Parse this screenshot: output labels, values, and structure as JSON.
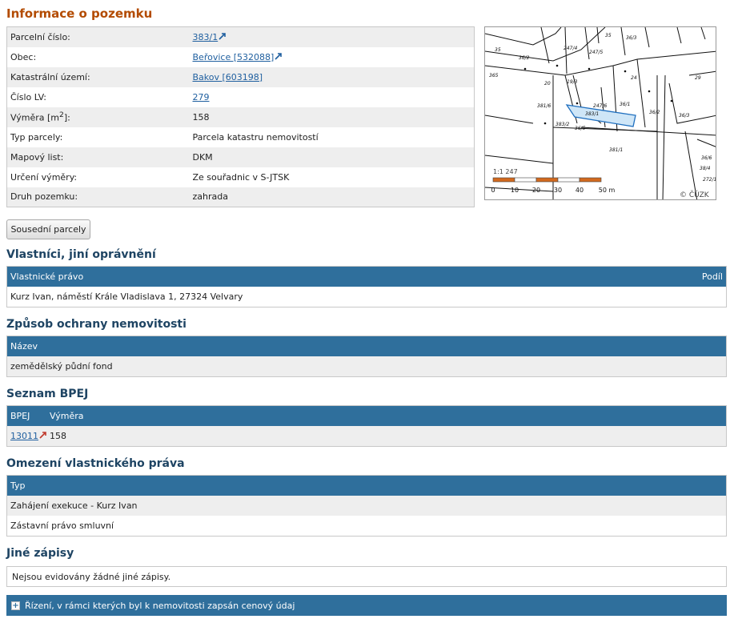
{
  "page_title": "Informace o pozemku",
  "info": {
    "rows": [
      {
        "label": "Parcelní číslo:",
        "value": "383/1",
        "link": true
      },
      {
        "label": "Obec:",
        "value": "Beřovice [532088]",
        "link": true
      },
      {
        "label": "Katastrální území:",
        "value": "Bakov [603198]",
        "link": true
      },
      {
        "label": "Číslo LV:",
        "value": "279",
        "link": true
      },
      {
        "label": "Výměra [m2]:",
        "value": "158",
        "link": false
      },
      {
        "label": "Typ parcely:",
        "value": "Parcela katastru nemovitostí",
        "link": false
      },
      {
        "label": "Mapový list:",
        "value": "DKM",
        "link": false
      },
      {
        "label": "Určení výměry:",
        "value": "Ze souřadnic v S-JTSK",
        "link": false
      },
      {
        "label": "Druh pozemku:",
        "value": "zahrada",
        "link": false
      }
    ],
    "area_label_prefix": "Výměra [m",
    "area_label_sup": "2",
    "area_label_suffix": "]:"
  },
  "map": {
    "scale_text": "1:1 247",
    "scale_ticks": [
      "0",
      "10",
      "20",
      "30",
      "40",
      "50 m"
    ],
    "copyright": "© ČÚZK",
    "parcel_labels": [
      "35",
      "36/2",
      "247/4",
      "247/5",
      "36/1",
      "36/3",
      "36/4",
      "365",
      "20",
      "19/3",
      "247/6",
      "24",
      "29",
      "36/1",
      "36/2",
      "36/3",
      "381/6",
      "383/1",
      "383/2",
      "36/5",
      "381/1",
      "38/4",
      "272/1",
      "36/6"
    ]
  },
  "buttons": {
    "neighbors": "Sousední parcely"
  },
  "owners": {
    "title": "Vlastníci, jiní oprávnění",
    "col_right": "Vlastnické právo",
    "col_share": "Podíl",
    "rows": [
      "Kurz Ivan, náměstí Krále Vladislava 1, 27324 Velvary"
    ]
  },
  "protection": {
    "title": "Způsob ochrany nemovitosti",
    "col_name": "Název",
    "rows": [
      "zemědělský půdní fond"
    ]
  },
  "bpej": {
    "title": "Seznam BPEJ",
    "col_code": "BPEJ",
    "col_area": "Výměra",
    "rows": [
      {
        "code": "13011",
        "area": "158"
      }
    ]
  },
  "restrictions": {
    "title": "Omezení vlastnického práva",
    "col_type": "Typ",
    "rows": [
      "Zahájení exekuce - Kurz Ivan",
      "Zástavní právo smluvní"
    ]
  },
  "other": {
    "title": "Jiné zápisy",
    "none_text": "Nejsou evidovány žádné jiné zápisy."
  },
  "proceedings": {
    "label": "Řízení, v rámci kterých byl k nemovitosti zapsán cenový údaj"
  },
  "colors": {
    "title_orange": "#b34b00",
    "header_blue": "#2f6f9c",
    "section_blue": "#1e4463",
    "link_blue": "#1f5f9f",
    "parcel_fill": "#cfe6f7"
  }
}
